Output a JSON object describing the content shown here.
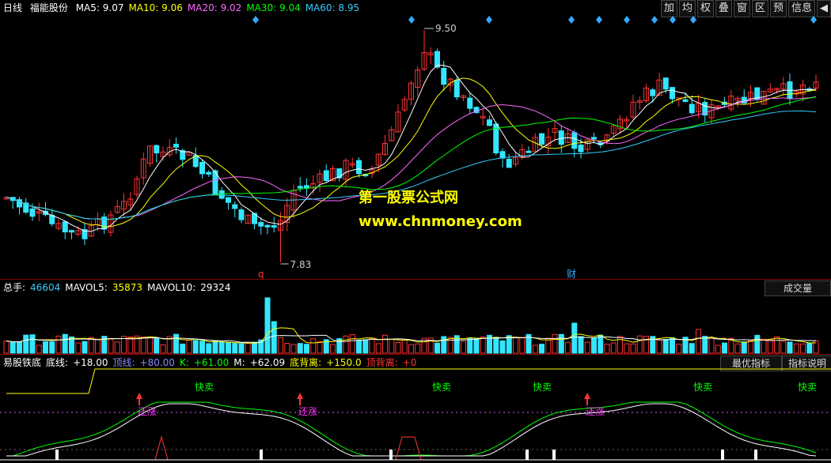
{
  "main_header": {
    "period": "日线",
    "stock": "福能股份",
    "ma": [
      {
        "label": "MA5: 9.07",
        "color": "#ffffff"
      },
      {
        "label": "MA10: 9.06",
        "color": "#ffff00"
      },
      {
        "label": "MA20: 9.02",
        "color": "#ff66ff"
      },
      {
        "label": "MA30: 9.04",
        "color": "#00ff00"
      },
      {
        "label": "MA60: 8.95",
        "color": "#33ccff"
      }
    ]
  },
  "toolbar": [
    "加",
    "均",
    "权",
    "叠",
    "窗",
    "区",
    "预",
    "信息",
    "◀"
  ],
  "price_annotations": {
    "high": "9.50",
    "low": "7.83",
    "q_marker": "q",
    "cai_marker": "财"
  },
  "watermark": {
    "line1": "第一股票公式网",
    "line2": "www.chnmoney.com"
  },
  "volume_header": {
    "items": [
      {
        "label": "总手:",
        "value": "46604",
        "color": "#33ccff"
      },
      {
        "label": "MAVOL5:",
        "value": "35873",
        "color": "#ffff00"
      },
      {
        "label": "MAVOL10:",
        "value": "29324",
        "color": "#ffffff"
      }
    ],
    "button": "成交量"
  },
  "indicator_header": {
    "name": "易股铁底",
    "items": [
      {
        "label": "底线:",
        "value": "+18.00",
        "color": "#ffffff"
      },
      {
        "label": "顶线:",
        "value": "+80.00",
        "color": "#8888ff"
      },
      {
        "label": "K:",
        "value": "+61.00",
        "color": "#00ff00"
      },
      {
        "label": "M:",
        "value": "+62.09",
        "color": "#ffffff"
      },
      {
        "label": "底背离:",
        "value": "+150.0",
        "color": "#ffff00"
      },
      {
        "label": "顶背离:",
        "value": "+0",
        "color": "#ff3333"
      }
    ],
    "buttons": [
      "最优指标",
      "指标说明"
    ]
  },
  "signals": {
    "sell_label": "快卖",
    "rise_label": "还涨"
  },
  "colors": {
    "up": "#ff3333",
    "down": "#33e6ff",
    "ma5": "#ffffff",
    "ma10": "#ffff00",
    "ma20": "#ff66ff",
    "ma30": "#00ff00",
    "ma60": "#33ccff"
  },
  "chart_data": {
    "type": "candlestick",
    "ylim": [
      7.6,
      9.75
    ],
    "high_marker": 9.5,
    "low_marker": 7.83
  }
}
